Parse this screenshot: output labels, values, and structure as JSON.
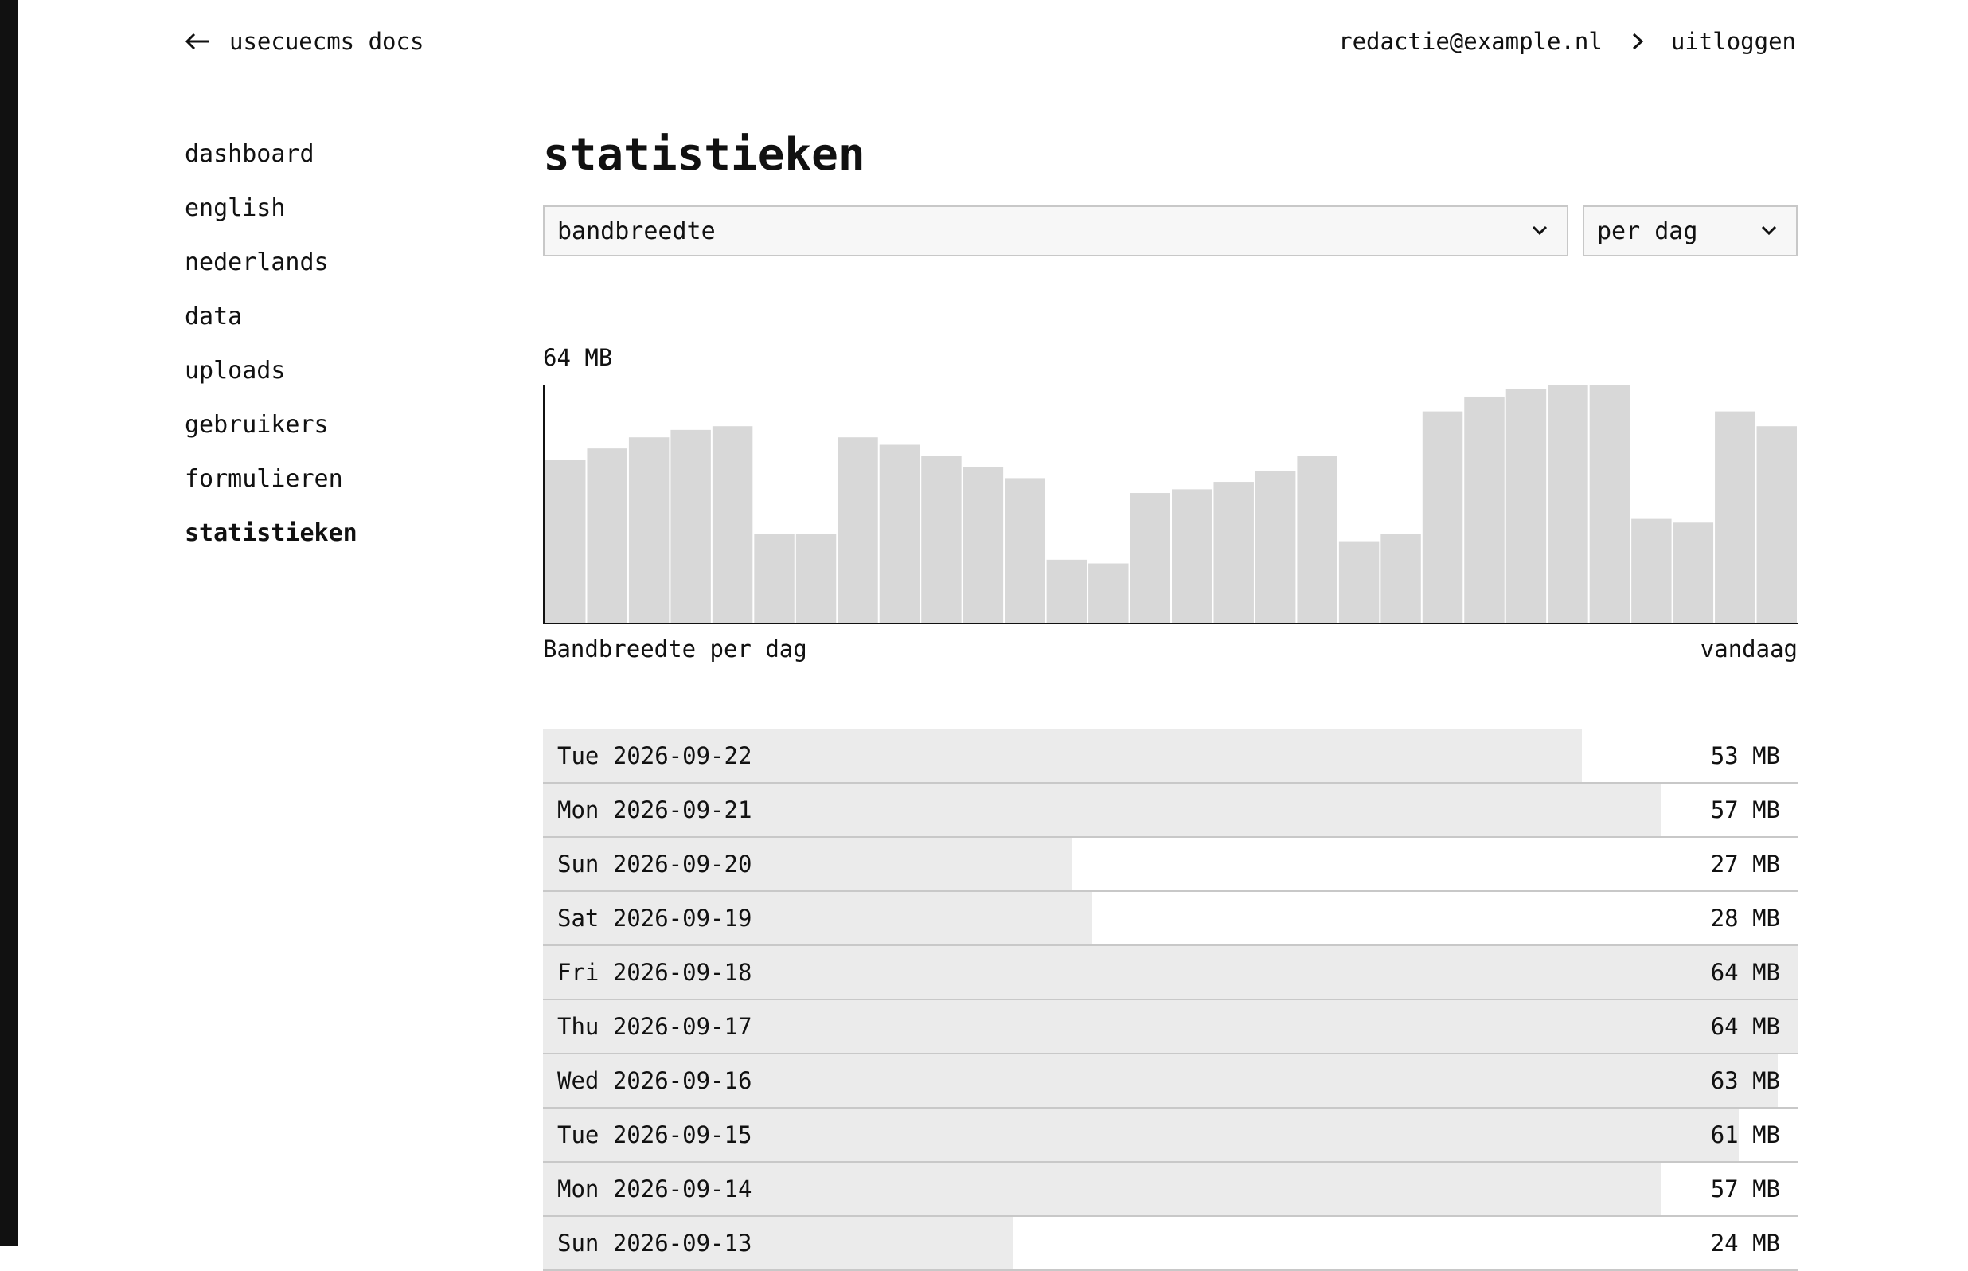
{
  "header": {
    "back_label": "usecuecms docs",
    "user_email": "redactie@example.nl",
    "logout_label": "uitloggen"
  },
  "sidebar": {
    "items": [
      {
        "label": "dashboard"
      },
      {
        "label": "english"
      },
      {
        "label": "nederlands"
      },
      {
        "label": "data"
      },
      {
        "label": "uploads"
      },
      {
        "label": "gebruikers"
      },
      {
        "label": "formulieren"
      },
      {
        "label": "statistieken",
        "active": true
      }
    ]
  },
  "main": {
    "title": "statistieken",
    "metric_select": {
      "value": "bandbreedte"
    },
    "period_select": {
      "value": "per dag"
    }
  },
  "chart_data": {
    "type": "bar",
    "max_label": "64 MB",
    "caption": "Bandbreedte per dag",
    "right_label": "vandaag",
    "ylim": [
      0,
      64
    ],
    "values": [
      44,
      47,
      50,
      52,
      53,
      24,
      24,
      50,
      48,
      45,
      42,
      39,
      17,
      16,
      35,
      36,
      38,
      41,
      45,
      22,
      24,
      57,
      61,
      63,
      64,
      64,
      28,
      27,
      57,
      53
    ],
    "colors": {
      "bar": "#d8d8d8",
      "axis": "#111111"
    }
  },
  "table": {
    "rows": [
      {
        "day": "Tue 2026-09-22",
        "value": "53 MB",
        "mb": 53
      },
      {
        "day": "Mon 2026-09-21",
        "value": "57 MB",
        "mb": 57
      },
      {
        "day": "Sun 2026-09-20",
        "value": "27 MB",
        "mb": 27
      },
      {
        "day": "Sat 2026-09-19",
        "value": "28 MB",
        "mb": 28
      },
      {
        "day": "Fri 2026-09-18",
        "value": "64 MB",
        "mb": 64
      },
      {
        "day": "Thu 2026-09-17",
        "value": "64 MB",
        "mb": 64
      },
      {
        "day": "Wed 2026-09-16",
        "value": "63 MB",
        "mb": 63
      },
      {
        "day": "Tue 2026-09-15",
        "value": "61 MB",
        "mb": 61
      },
      {
        "day": "Mon 2026-09-14",
        "value": "57 MB",
        "mb": 57
      },
      {
        "day": "Sun 2026-09-13",
        "value": "24 MB",
        "mb": 24
      }
    ]
  }
}
